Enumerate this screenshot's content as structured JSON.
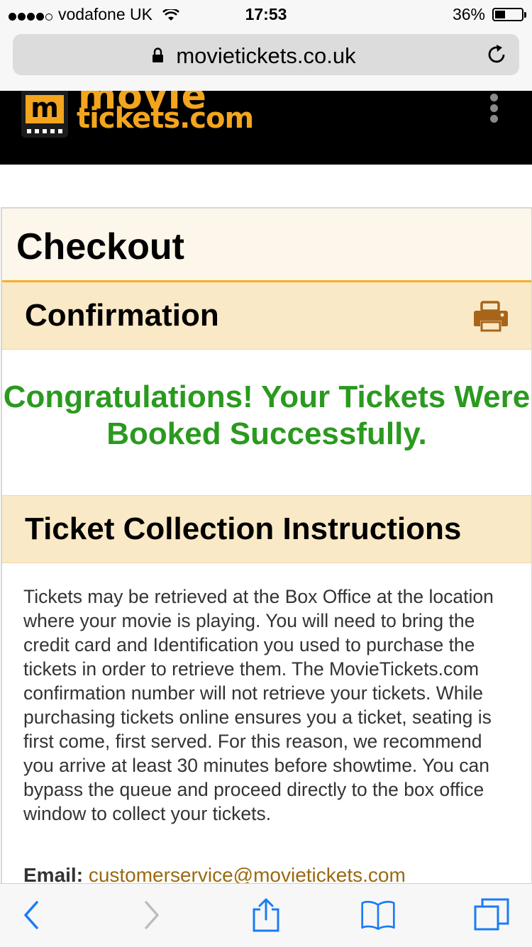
{
  "status_bar": {
    "carrier": "vodafone UK",
    "time": "17:53",
    "battery_percent": "36%",
    "signal_bars": 4,
    "battery_level": 0.36
  },
  "browser": {
    "url": "movietickets.co.uk"
  },
  "site": {
    "logo_letter": "m",
    "logo_top": "movie",
    "logo_bottom": "tickets.com",
    "brand_color": "#f3a51e"
  },
  "checkout": {
    "title": "Checkout",
    "confirmation_title": "Confirmation",
    "congrats_message": "Congratulations! Your Tickets Were Booked Successfully.",
    "collection_title": "Ticket Collection Instructions",
    "instructions": "Tickets may be retrieved at the Box Office at the location where your movie is playing. You will need to bring the credit card and Identification you used to purchase the tickets in order to retrieve them. The MovieTickets.com confirmation number will not retrieve your tickets. While purchasing tickets online ensures you a ticket, seating is first come, first served. For this reason, we recommend you arrive at least 30 minutes before showtime. You can bypass the queue and proceed directly to the box office window to collect your tickets.",
    "email_label": "Email:",
    "email_value": "customerservice@movietickets.com",
    "success_color": "#2a9a1e"
  },
  "toolbar": {
    "icons": [
      "back-icon",
      "forward-icon",
      "share-icon",
      "bookmarks-icon",
      "tabs-icon"
    ]
  }
}
